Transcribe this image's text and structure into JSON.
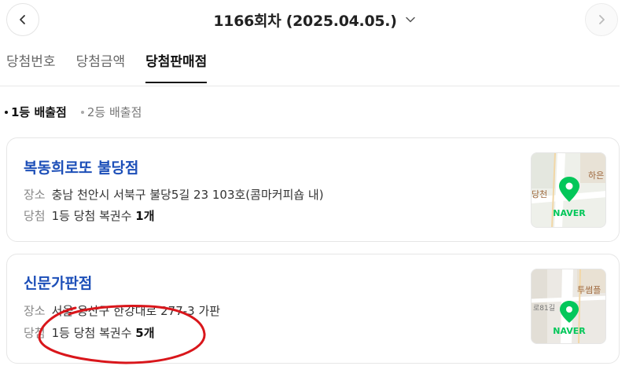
{
  "header": {
    "round_title": "1166회차 (2025.04.05.)",
    "prev_icon": "chevron-left-icon",
    "next_icon": "chevron-right-icon",
    "dropdown_icon": "chevron-down-icon"
  },
  "tabs": [
    {
      "label": "당첨번호",
      "active": false
    },
    {
      "label": "당첨금액",
      "active": false
    },
    {
      "label": "당첨판매점",
      "active": true
    }
  ],
  "filters": [
    {
      "label": "1등 배출점",
      "active": true
    },
    {
      "label": "2등 배출점",
      "active": false
    }
  ],
  "stores": [
    {
      "name": "복동희로또 불당점",
      "address_label": "장소",
      "address": "충남 천안시 서북구 불당5길 23 103호(콤마커피숍 내)",
      "win_label": "당첨",
      "win_prefix": "1등 당첨 복권수",
      "win_count": "1개",
      "map_text": "하은",
      "map_text2": "당천",
      "map_brand": "NAVER"
    },
    {
      "name": "신문가판점",
      "address_label": "장소",
      "address": "서울 용산구 한강대로 277-3 가판",
      "win_label": "당첨",
      "win_prefix": "1등 당첨 복권수",
      "win_count": "5개",
      "map_text": "투썸플",
      "map_text2": "로81길",
      "map_brand": "NAVER"
    }
  ],
  "colors": {
    "store_name": "#1d4fb8",
    "map_pin": "#03c75a",
    "annotation": "#d9161b"
  }
}
